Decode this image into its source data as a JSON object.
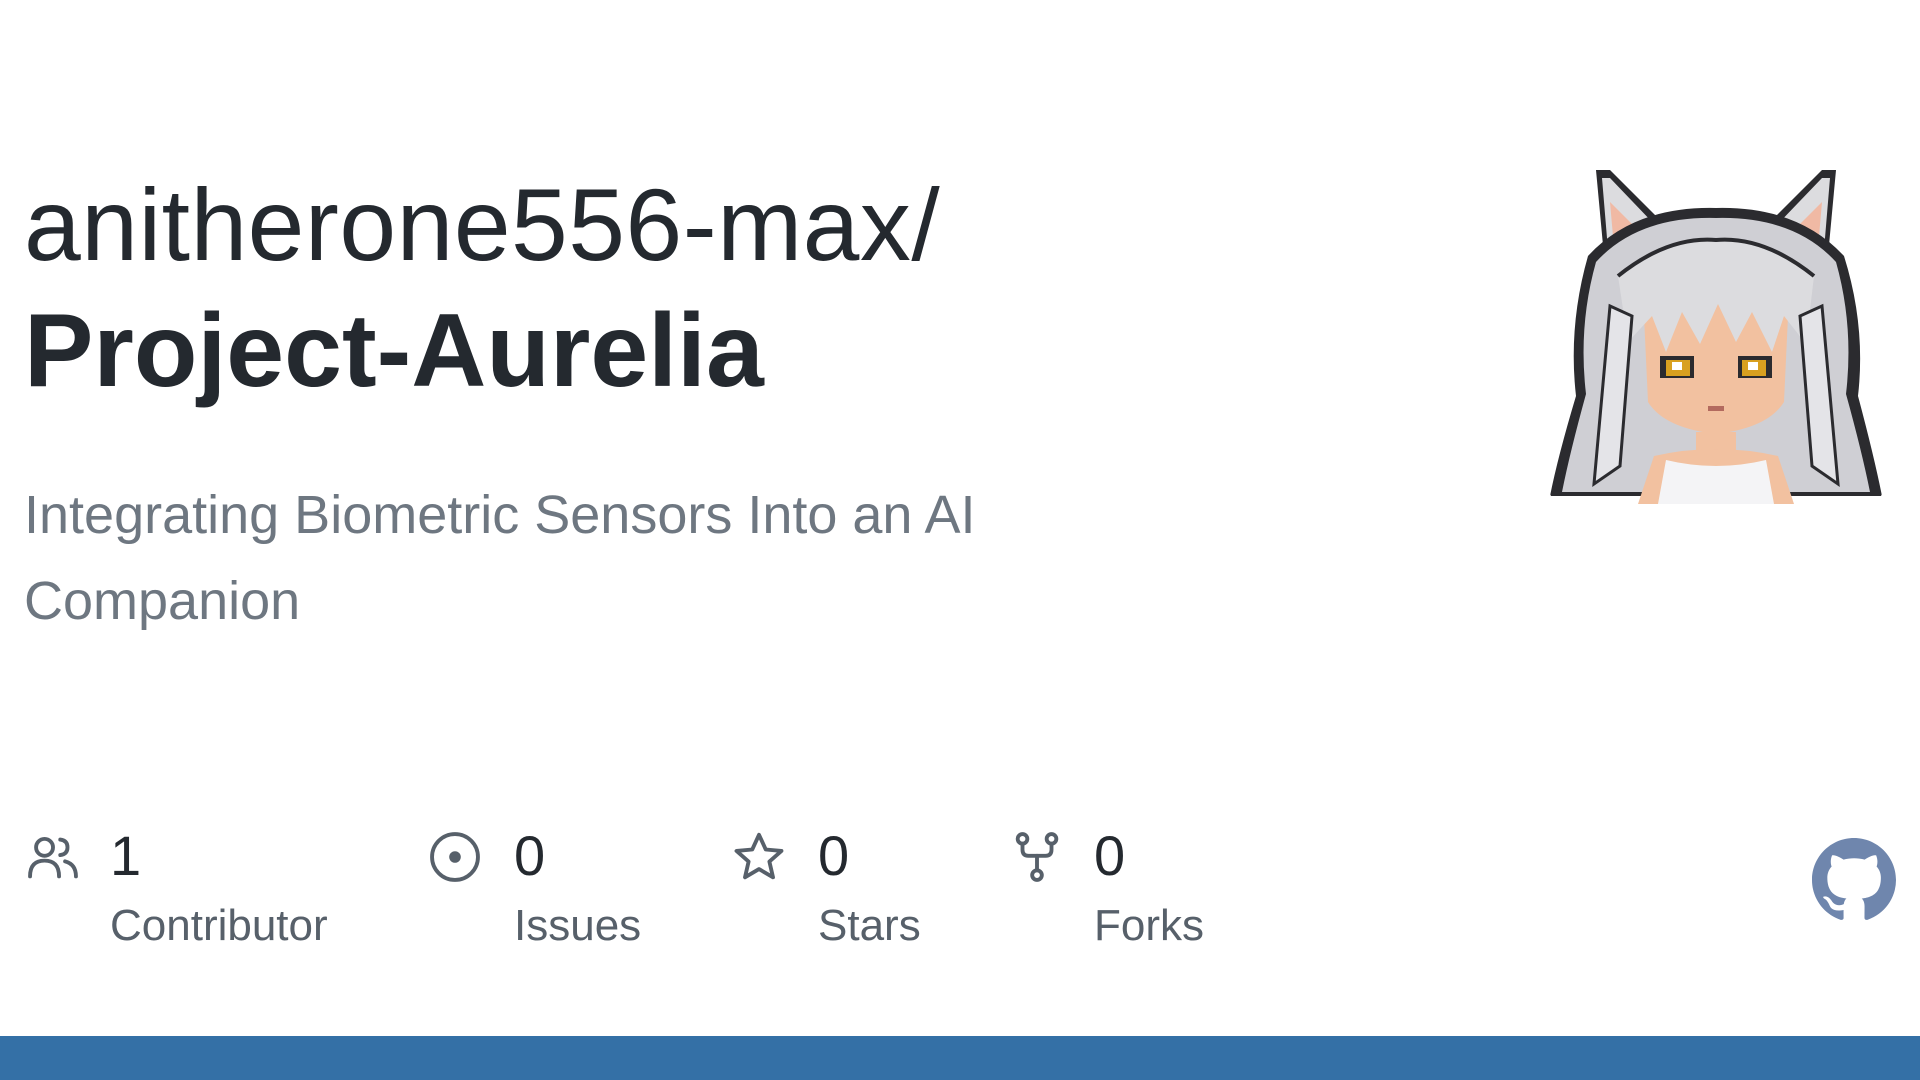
{
  "repo": {
    "owner": "anitherone556-max/",
    "name": "Project-Aurelia",
    "description": "Integrating Biometric Sensors Into an AI Companion"
  },
  "stats": [
    {
      "icon": "people-icon",
      "count": "1",
      "label": "Contributor"
    },
    {
      "icon": "issue-icon",
      "count": "0",
      "label": "Issues"
    },
    {
      "icon": "star-icon",
      "count": "0",
      "label": "Stars"
    },
    {
      "icon": "fork-icon",
      "count": "0",
      "label": "Forks"
    }
  ],
  "avatar": {
    "icon": "avatar-pixel-cat-girl"
  },
  "brand": {
    "icon": "github-mark-icon"
  },
  "colors": {
    "text_primary": "#24292f",
    "text_secondary": "#6e7781",
    "icon": "#57606a",
    "bottom_bar": "#3470a6",
    "github_mark": "#6f86ad"
  }
}
